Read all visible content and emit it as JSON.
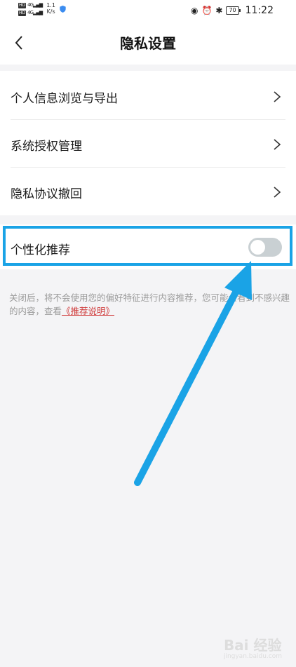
{
  "status_bar": {
    "sim1": "4G",
    "sim2": "4G",
    "speed_value": "1.1",
    "speed_unit": "K/s",
    "battery": "70",
    "time": "11:22"
  },
  "header": {
    "title": "隐私设置"
  },
  "settings": {
    "items": [
      {
        "label": "个人信息浏览与导出"
      },
      {
        "label": "系统授权管理"
      },
      {
        "label": "隐私协议撤回"
      }
    ],
    "personalized": {
      "label": "个性化推荐",
      "enabled": false
    }
  },
  "description": {
    "text": "关闭后，将不会使用您的偏好特征进行内容推荐，您可能会看到不感兴趣的内容，查看",
    "link": "《推荐说明》"
  },
  "colors": {
    "highlight": "#1aa3e6",
    "link": "#d03a3a",
    "toggle_off": "#c9d0d3"
  },
  "watermark": {
    "text": "Bai  经验",
    "sub": "jingyan.baidu.com"
  }
}
